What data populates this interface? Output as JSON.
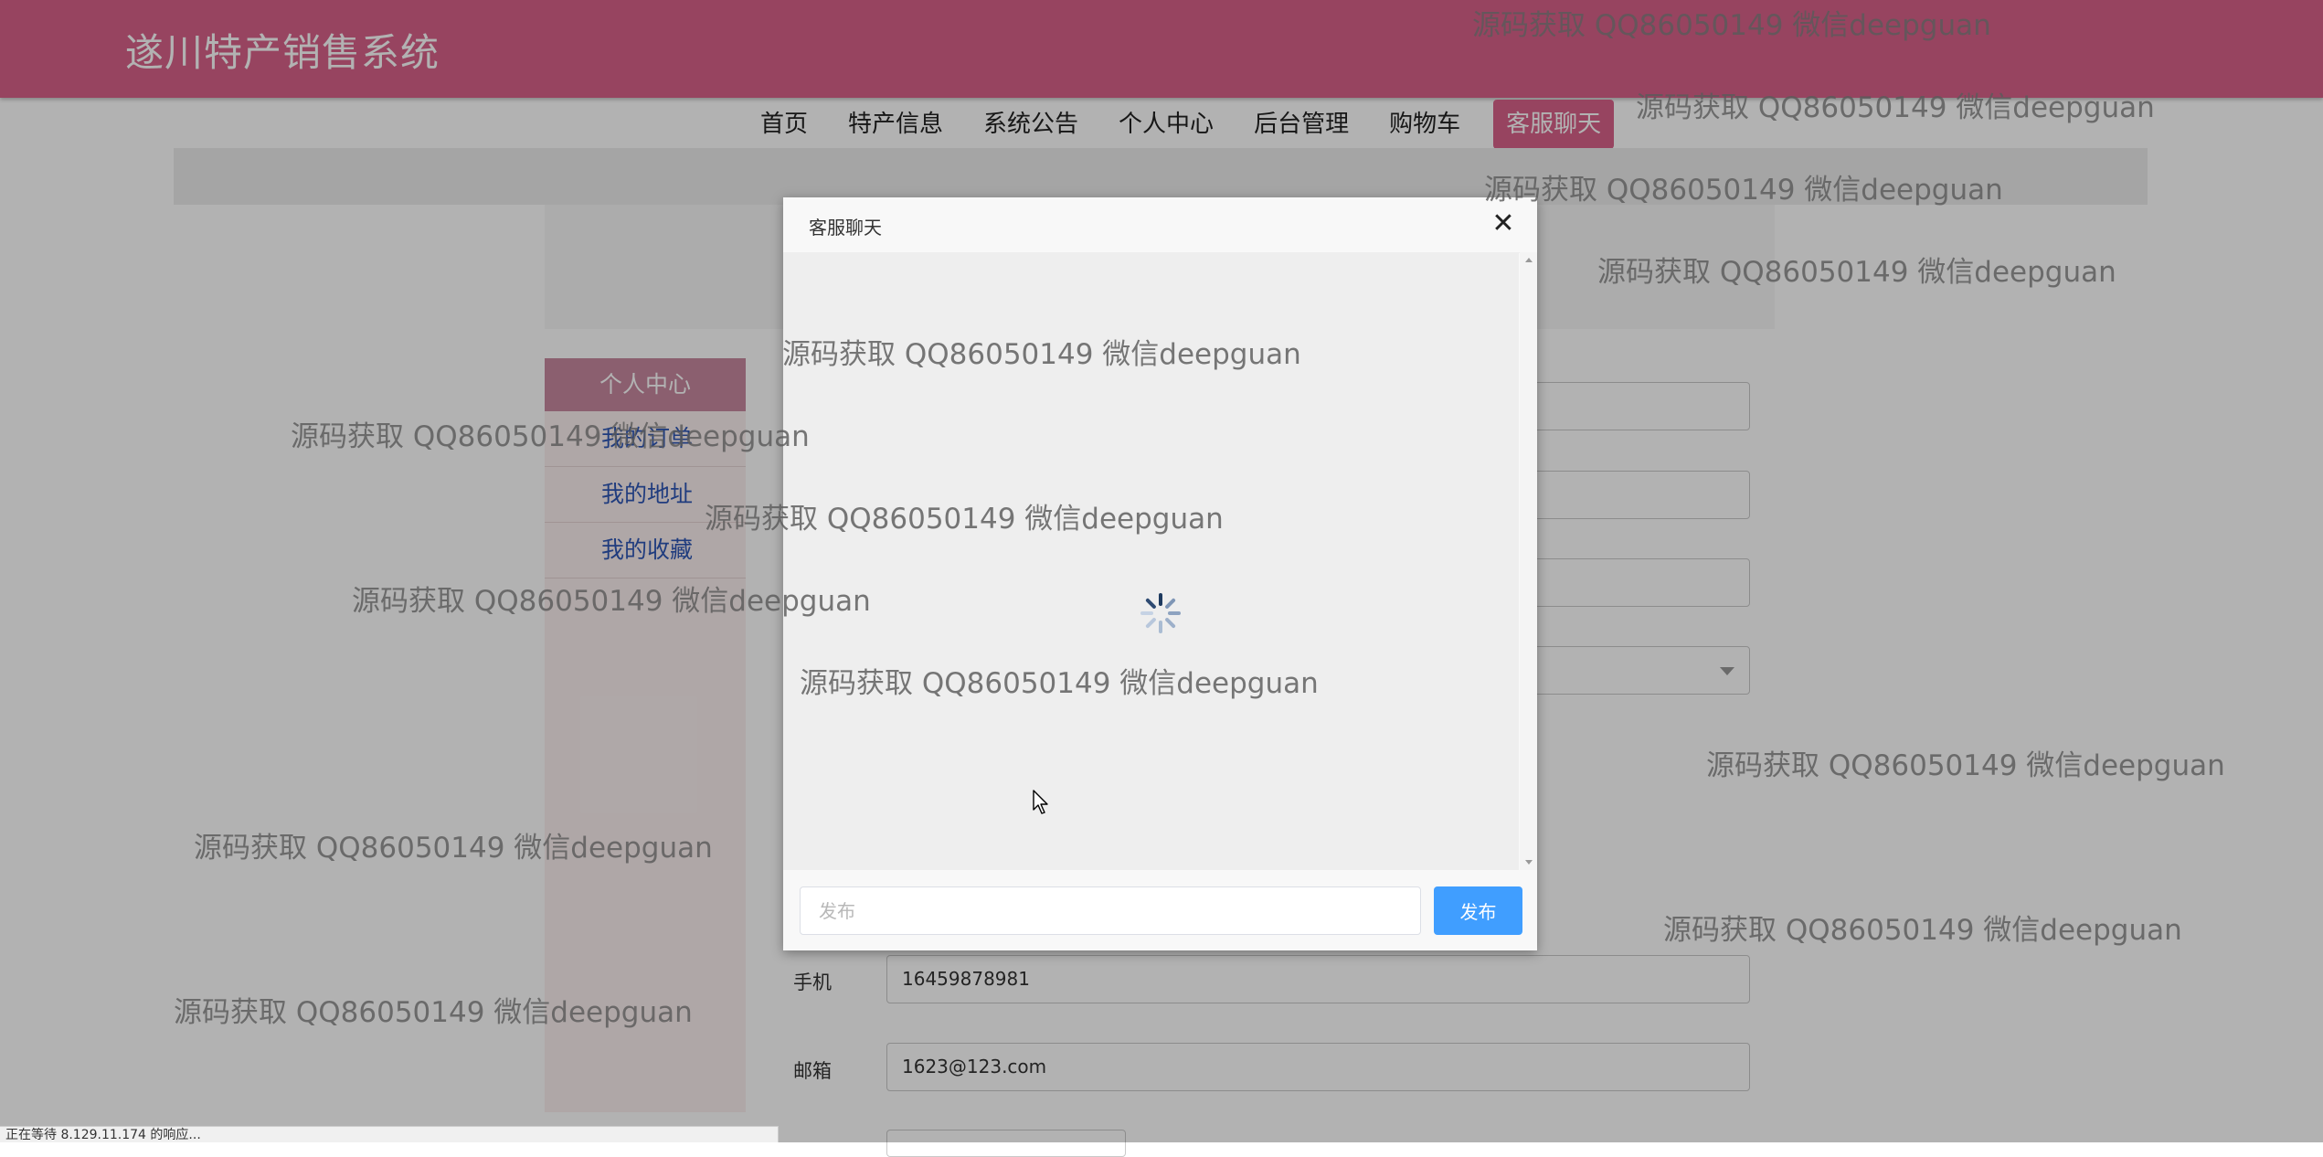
{
  "site": {
    "title": "遂川特产销售系统"
  },
  "nav": {
    "items": [
      "首页",
      "特产信息",
      "系统公告",
      "个人中心",
      "后台管理",
      "购物车"
    ],
    "active": "客服聊天"
  },
  "sidebar": {
    "title": "个人中心",
    "items": [
      "我的订单",
      "我的地址",
      "我的收藏"
    ]
  },
  "form": {
    "phone_label": "手机",
    "phone_value": "16459878981",
    "email_label": "邮箱",
    "email_value": "1623@123.com"
  },
  "dialog": {
    "title": "客服聊天",
    "close_icon": "close-icon",
    "input_placeholder": "发布",
    "post_label": "发布"
  },
  "watermark": {
    "text": "源码获取 QQ86050149 微信deepguan"
  },
  "status_bar": {
    "text": "正在等待 8.129.11.174 的响应..."
  }
}
